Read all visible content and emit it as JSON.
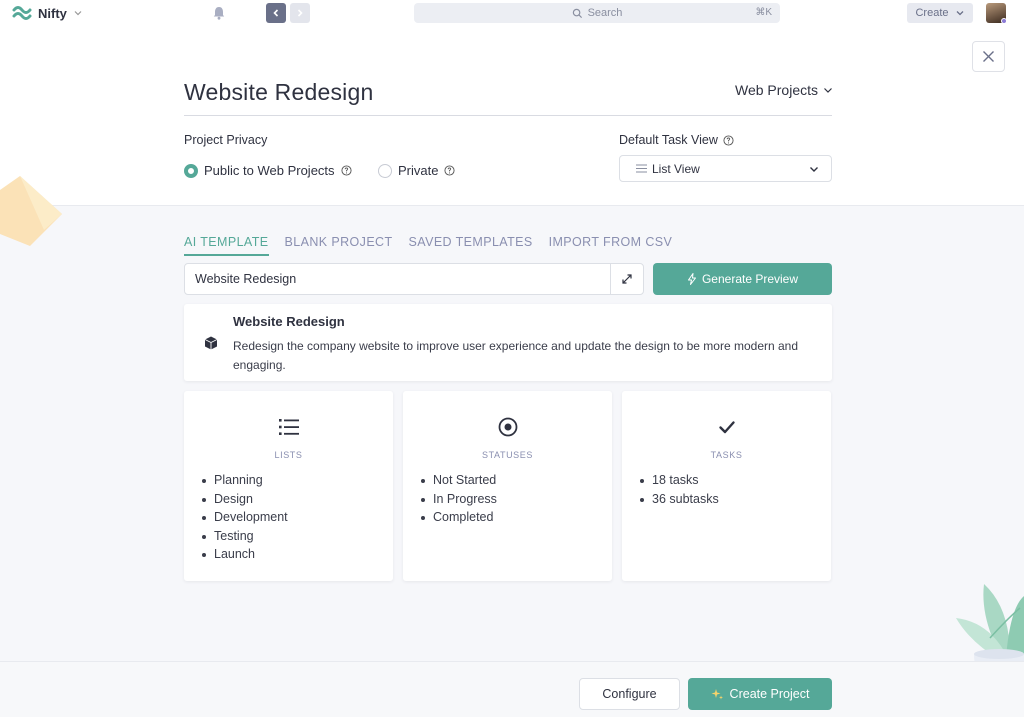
{
  "topbar": {
    "app_name": "Nifty",
    "search_placeholder": "Search",
    "search_shortcut": "⌘K",
    "create_label": "Create"
  },
  "modal": {
    "title": "Website Redesign",
    "project_group": "Web Projects",
    "privacy": {
      "label": "Project Privacy",
      "options": [
        {
          "label": "Public to Web Projects",
          "selected": true
        },
        {
          "label": "Private",
          "selected": false
        }
      ]
    },
    "default_task_view": {
      "label": "Default Task View",
      "value": "List View"
    },
    "tabs": [
      {
        "label": "AI TEMPLATE",
        "active": true
      },
      {
        "label": "BLANK PROJECT",
        "active": false
      },
      {
        "label": "SAVED TEMPLATES",
        "active": false
      },
      {
        "label": "IMPORT FROM CSV",
        "active": false
      }
    ],
    "prompt_value": "Website Redesign",
    "generate_label": "Generate Preview",
    "preview": {
      "title": "Website Redesign",
      "description": "Redesign the company website to improve user experience and update the design to be more modern and engaging."
    },
    "cards": {
      "lists": {
        "heading": "LISTS",
        "items": [
          "Planning",
          "Design",
          "Development",
          "Testing",
          "Launch"
        ]
      },
      "statuses": {
        "heading": "STATUSES",
        "items": [
          "Not Started",
          "In Progress",
          "Completed"
        ]
      },
      "tasks": {
        "heading": "TASKS",
        "items": [
          "18 tasks",
          "36 subtasks"
        ]
      }
    },
    "footer": {
      "configure_label": "Configure",
      "create_label": "Create Project"
    }
  },
  "colors": {
    "accent": "#55a898",
    "tab_inactive": "#8a8fb0",
    "text": "#2f3240"
  }
}
